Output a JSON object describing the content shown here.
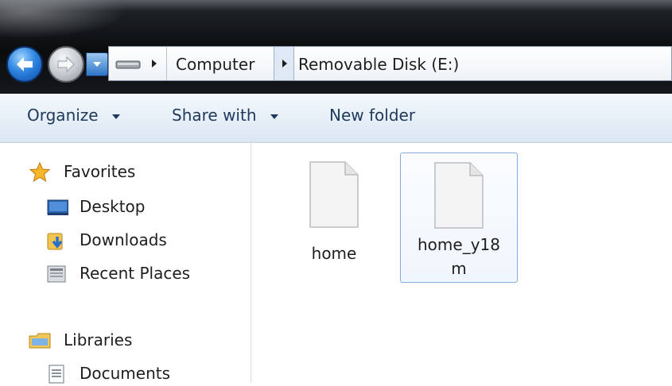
{
  "address_bar": {
    "breadcrumbs": [
      "Computer",
      "Removable Disk (E:)"
    ]
  },
  "toolbar": {
    "organize_label": "Organize",
    "share_label": "Share with",
    "new_folder_label": "New folder"
  },
  "nav_pane": {
    "favorites": {
      "label": "Favorites",
      "items": [
        {
          "label": "Desktop",
          "icon": "desktop-icon"
        },
        {
          "label": "Downloads",
          "icon": "downloads-icon"
        },
        {
          "label": "Recent Places",
          "icon": "recent-places-icon"
        }
      ]
    },
    "libraries": {
      "label": "Libraries",
      "items": [
        {
          "label": "Documents",
          "icon": "documents-icon"
        }
      ]
    }
  },
  "files": [
    {
      "name": "home",
      "selected": false,
      "icon": "blank-file-icon"
    },
    {
      "name_line1": "home_y18",
      "name_line2": "m",
      "selected": true,
      "icon": "blank-file-icon"
    }
  ],
  "colors": {
    "accent": "#2f86e0",
    "toolbar_text": "#1e395b",
    "selection_border": "#84acdd"
  }
}
